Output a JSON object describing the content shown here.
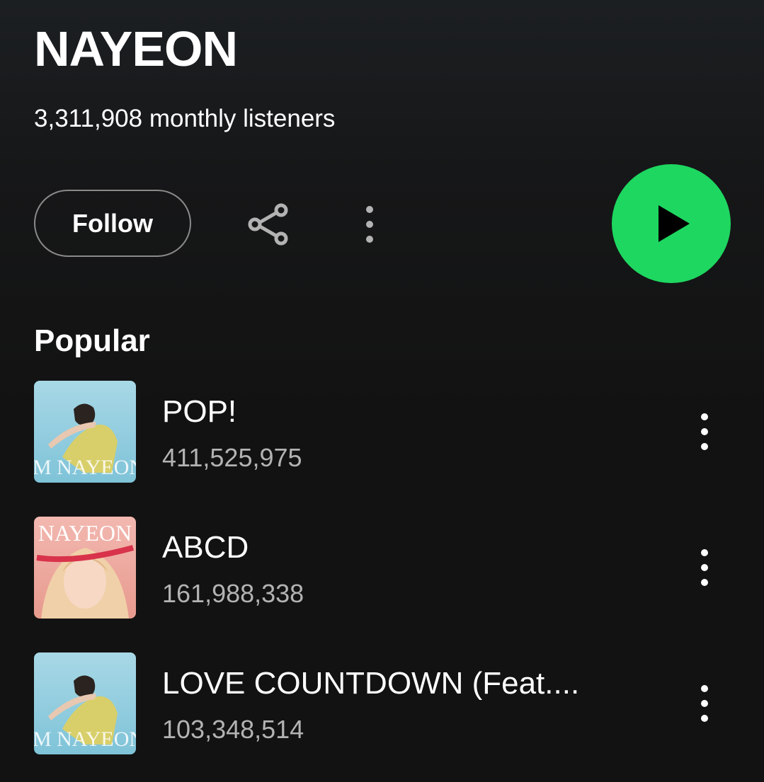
{
  "artist": {
    "name": "NAYEON",
    "monthly_listeners": "3,311,908 monthly listeners"
  },
  "actions": {
    "follow_label": "Follow",
    "share_icon": "share-icon",
    "more_icon": "more-vertical-icon",
    "play_icon": "play-icon"
  },
  "colors": {
    "accent": "#1ed760",
    "background": "#121212",
    "secondary_text": "#b3b3b3"
  },
  "popular": {
    "title": "Popular",
    "tracks": [
      {
        "title": "POP!",
        "plays": "411,525,975",
        "cover_text": "IM NAYEON"
      },
      {
        "title": "ABCD",
        "plays": "161,988,338",
        "cover_text": "NAYEON"
      },
      {
        "title": "LOVE COUNTDOWN (Feat....",
        "plays": "103,348,514",
        "cover_text": "IM NAYEON"
      }
    ]
  }
}
